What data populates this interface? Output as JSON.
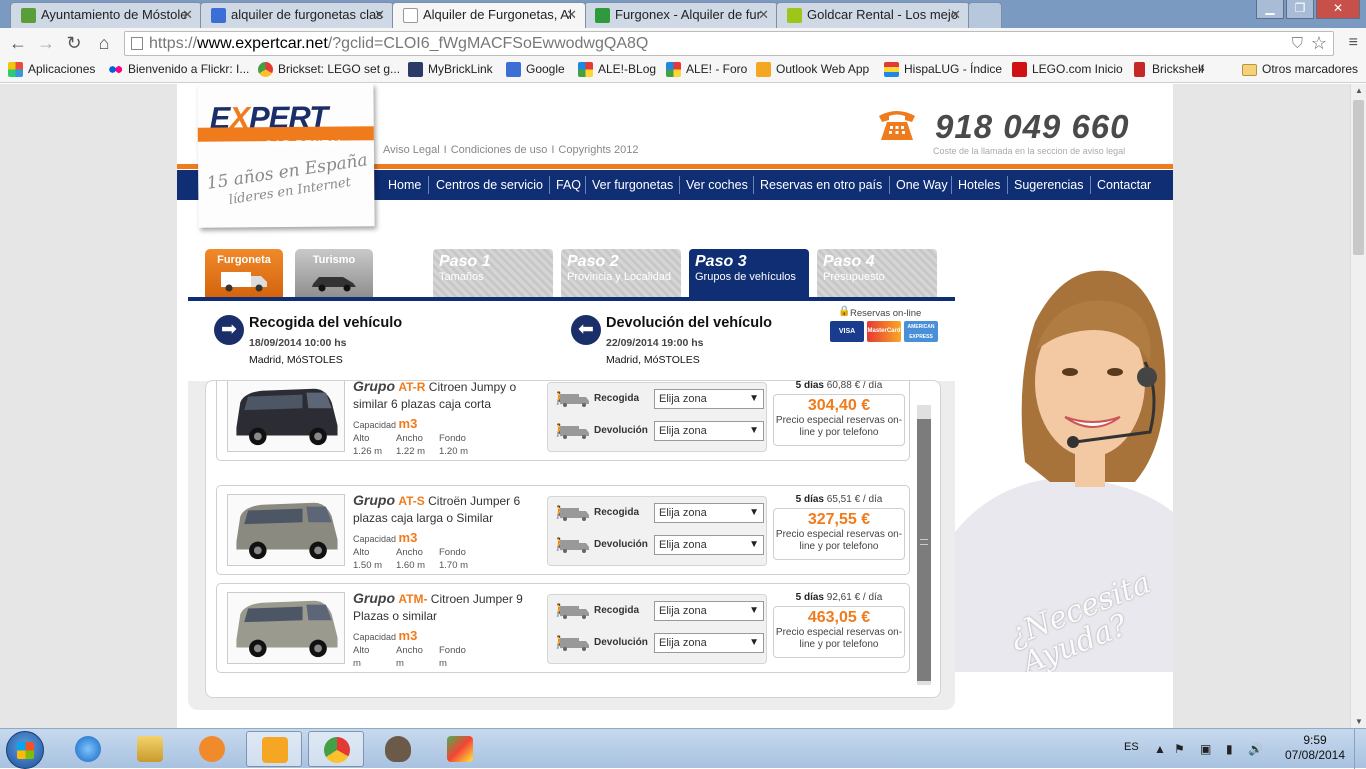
{
  "browser": {
    "tabs": [
      {
        "title": "Ayuntamiento de Móstole",
        "active": false
      },
      {
        "title": "alquiler de furgonetas clas",
        "active": false
      },
      {
        "title": "Alquiler de Furgonetas, Al",
        "active": true
      },
      {
        "title": "Furgonex - Alquiler de fur",
        "active": false
      },
      {
        "title": "Goldcar Rental - Los mejo",
        "active": false
      }
    ],
    "url": {
      "protocol": "https://",
      "host": "www.expertcar.net",
      "rest": "/?gclid=CLOI6_fWgMACFSoEwwodwgQA8Q"
    },
    "bookmarks": [
      {
        "label": "Aplicaciones",
        "icon": "apps-grid-icon"
      },
      {
        "label": "Bienvenido a Flickr: I...",
        "icon": "flickr-icon"
      },
      {
        "label": "Brickset: LEGO set g...",
        "icon": "brickset-icon"
      },
      {
        "label": "MyBrickLink",
        "icon": "bricklink-icon"
      },
      {
        "label": "Google",
        "icon": "google-icon"
      },
      {
        "label": "ALE!-BLog",
        "icon": "ale-icon"
      },
      {
        "label": "ALE! - Foro",
        "icon": "ale-icon"
      },
      {
        "label": "Outlook Web App",
        "icon": "outlook-icon"
      },
      {
        "label": "HispaLUG - Índice",
        "icon": "hispalug-icon"
      },
      {
        "label": "LEGO.com Inicio",
        "icon": "lego-icon"
      },
      {
        "label": "Brickshelf",
        "icon": "brickshelf-icon"
      },
      {
        "label": "»",
        "icon": ""
      },
      {
        "label": "Otros marcadores",
        "icon": "folder-icon"
      }
    ]
  },
  "site": {
    "logo": {
      "word_pre": "E",
      "word_x": "X",
      "word_post": "PERT",
      "subtitle": "CAR RENTAL",
      "tag1": "15 años en España",
      "tag2": "líderes en Internet"
    },
    "toplinks": [
      "Aviso Legal",
      "Condiciones de uso",
      "Copyrights 2012"
    ],
    "phone": {
      "number": "918 049 660",
      "note": "Coste de la llamada en la seccion de aviso legal"
    },
    "menu": [
      "Home",
      "Centros de servicio",
      "FAQ",
      "Ver furgonetas",
      "Ver coches",
      "Reservas en otro país",
      "One Way",
      "Hoteles",
      "Sugerencias",
      "Contactar"
    ],
    "vehicle_tabs": [
      "Furgoneta",
      "Turismo"
    ],
    "steps": [
      {
        "title": "Paso 1",
        "subtitle": "Tamaños",
        "active": false
      },
      {
        "title": "Paso 2",
        "subtitle": "Provincia y Localidad",
        "active": false
      },
      {
        "title": "Paso 3",
        "subtitle": "Grupos de vehículos",
        "active": true
      },
      {
        "title": "Paso 4",
        "subtitle": "Presupuesto",
        "active": false
      }
    ],
    "pickup": {
      "title": "Recogida del vehículo",
      "date": "18/09/2014 10:00 hs",
      "place": "Madrid, MóSTOLES"
    },
    "dropoff": {
      "title": "Devolución del vehículo",
      "date": "22/09/2014 19:00 hs",
      "place": "Madrid, MóSTOLES"
    },
    "online": {
      "label": "Reservas on-line",
      "cards": [
        "VISA",
        "MasterCard",
        "AMERICAN EXPRESS"
      ]
    },
    "vehicles": [
      {
        "group_word": "Grupo",
        "code": "AT-R",
        "desc": "Citroen Jumpy o similar 6 plazas caja corta",
        "cap_label": "Capacidad",
        "cap_unit": "m3",
        "dim_labels": [
          "Alto",
          "Ancho",
          "Fondo"
        ],
        "dims": [
          "1.26 m",
          "1.22 m",
          "1.20 m"
        ],
        "zones": [
          {
            "label": "Recogida",
            "value": "Elija zona"
          },
          {
            "label": "Devolución",
            "value": "Elija zona"
          }
        ],
        "days": "5 días",
        "per_day": "60,88 € / día",
        "total": "304,40 €",
        "note": "Precio especial reservas on-line y por telefono"
      },
      {
        "group_word": "Grupo",
        "code": "AT-S",
        "desc": "Citroën Jumper 6 plazas caja larga o Similar",
        "cap_label": "Capacidad",
        "cap_unit": "m3",
        "dim_labels": [
          "Alto",
          "Ancho",
          "Fondo"
        ],
        "dims": [
          "1.50 m",
          "1.60 m",
          "1.70 m"
        ],
        "zones": [
          {
            "label": "Recogida",
            "value": "Elija zona"
          },
          {
            "label": "Devolución",
            "value": "Elija zona"
          }
        ],
        "days": "5 días",
        "per_day": "65,51 € / día",
        "total": "327,55 €",
        "note": "Precio especial reservas on-line y por telefono"
      },
      {
        "group_word": "Grupo",
        "code": "ATM-",
        "desc": "Citroen Jumper 9 Plazas o similar",
        "cap_label": "Capacidad",
        "cap_unit": "m3",
        "dim_labels": [
          "Alto",
          "Ancho",
          "Fondo"
        ],
        "dims": [
          "m",
          "m",
          "m"
        ],
        "zones": [
          {
            "label": "Recogida",
            "value": "Elija zona"
          },
          {
            "label": "Devolución",
            "value": "Elija zona"
          }
        ],
        "days": "5 días",
        "per_day": "92,61 € / día",
        "total": "463,05 €",
        "note": "Precio especial reservas on-line y por telefono"
      }
    ],
    "help": {
      "line1": "¿Necesita",
      "line2": "Ayuda?"
    }
  },
  "taskbar": {
    "language": "ES",
    "time": "9:59",
    "date": "07/08/2014",
    "apps": [
      "internet-explorer-icon",
      "file-explorer-icon",
      "media-player-icon",
      "outlook-icon",
      "chrome-icon",
      "gimp-icon",
      "image-viewer-icon"
    ]
  },
  "colors": {
    "brand_orange": "#f07b1c",
    "brand_navy": "#0f2e74"
  }
}
